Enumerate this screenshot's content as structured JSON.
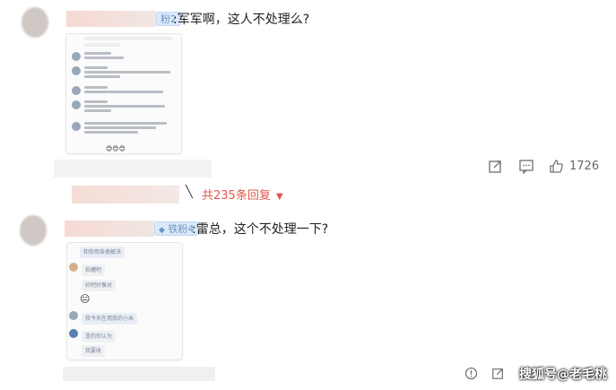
{
  "comments": [
    {
      "badge": "粉2",
      "text": ":军军啊，这人不处理么?",
      "actions": {
        "like_count": "1726"
      },
      "replies_label": "共235条回复",
      "chat_lines": [
        "微博可以❤了解一下",
        "小米，西瓜，请卡，和停至美，这里要果汪的都要学",
        "小米，官网品牌！头条收入量！",
        "小米的手机水平一般",
        "不管怎么样，我们的产品全要设计",
        "小米开始跑的是",
        "未知全部收入量！请本计入全都要理解！"
      ]
    },
    {
      "badge": "铁粉4",
      "text": ":雷总，这个不处理一下?",
      "chat_lines": [
        "和你用各类解决",
        "粘槽吧",
        "好吧好像对",
        "我今天在用我的小米",
        "是的你认为",
        "我要收"
      ]
    }
  ],
  "watermark": "搜狐号@老毛桃"
}
